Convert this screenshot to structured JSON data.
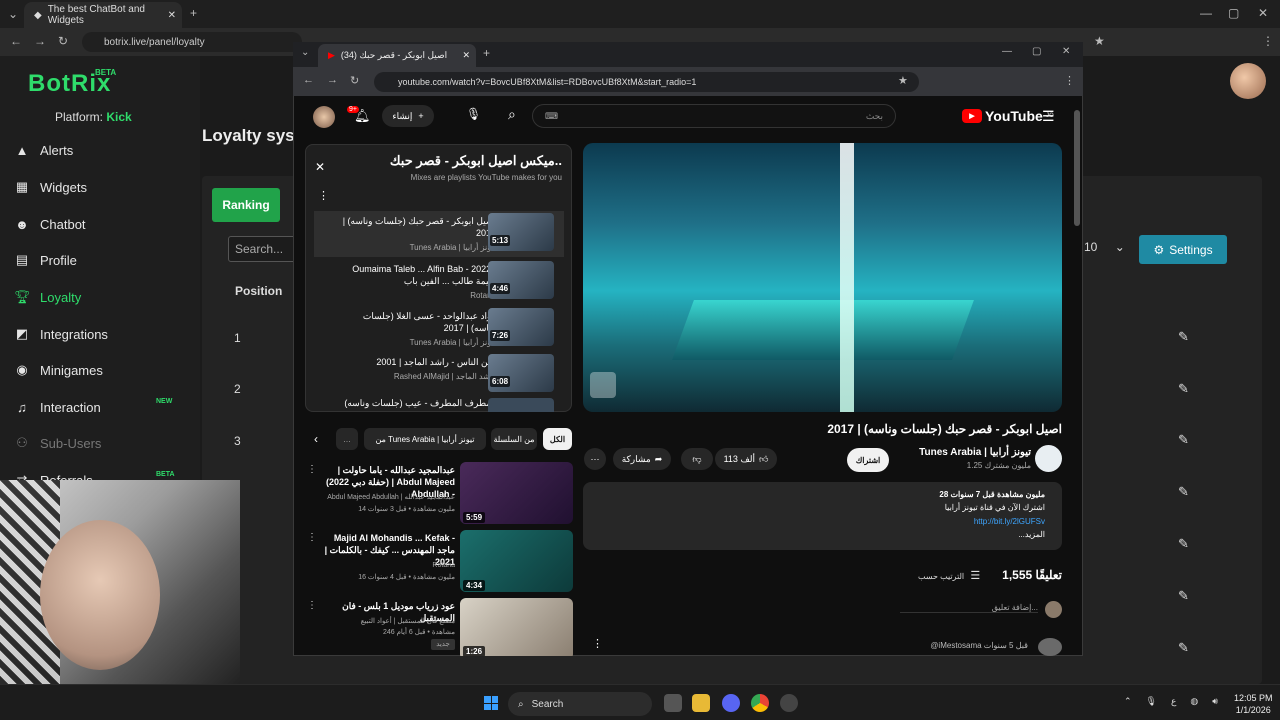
{
  "outer_browser": {
    "tab_title": "The best ChatBot and Widgets",
    "url": "botrix.live/panel/loyalty"
  },
  "botrix": {
    "brand": "BotRix",
    "beta": "BETA",
    "platform_label": "Platform:",
    "platform_value": "Kick",
    "nav": [
      {
        "label": "Alerts",
        "icon": "warning-icon"
      },
      {
        "label": "Widgets",
        "icon": "grid-icon"
      },
      {
        "label": "Chatbot",
        "icon": "robot-icon"
      },
      {
        "label": "Profile",
        "icon": "id-card-icon"
      },
      {
        "label": "Loyalty",
        "icon": "trophy-icon"
      },
      {
        "label": "Integrations",
        "icon": "integrations-icon"
      },
      {
        "label": "Minigames",
        "icon": "gamepad-icon"
      },
      {
        "label": "Interaction",
        "icon": "music-icon",
        "badge": "NEW"
      },
      {
        "label": "Sub-Users",
        "icon": "users-icon"
      },
      {
        "label": "Referrals",
        "icon": "referral-icon",
        "badge": "BETA"
      }
    ],
    "page_title": "Loyalty syst",
    "ranking_label": "Ranking",
    "search_placeholder": "Search...",
    "page_size": "10",
    "settings_label": "Settings",
    "col_position": "Position",
    "positions": [
      "1",
      "2",
      "3"
    ]
  },
  "youtube_window": {
    "tab_title": "(34) اصيل ابوبكر - قصر حبك",
    "url": "youtube.com/watch?v=BovcUBf8XtM&list=RDBovcUBf8XtM&start_radio=1",
    "logo_text": "YouTube",
    "logo_region": "JO",
    "search_placeholder": "بحث",
    "create_label": "إنشاء",
    "notif_count": "9+",
    "mix_title": "ميكس اصيل ابوبكر - قصر حبك..",
    "mix_subtitle": "Mixes are playlists YouTube makes for you",
    "playlist": [
      {
        "title": "اصيل ابوبكر - قصر حبك (جلسات وناسه) | 2017",
        "channel": "Tunes Arabia | تيونز أرابيا",
        "duration": "5:13"
      },
      {
        "title": "Oumaima Taleb ... Alfin Bab - 2022 | اميمة طالب ... الفين باب",
        "channel": "Rotana",
        "duration": "4:46"
      },
      {
        "title": "فؤاد عبدالواحد - عسى الغلا (جلسات وناسه) | 2017",
        "channel": "Tunes Arabia | تيونز أرابيا",
        "duration": "7:26"
      },
      {
        "title": "عين الناس - راشد الماجد | 2001",
        "channel": "Rashed AlMajid | راشد الماجد",
        "duration": "6:08"
      },
      {
        "title": "مطرف المطرف - عيب (جلسات وناسه) |",
        "channel": "",
        "duration": ""
      }
    ],
    "chips": [
      "الكل",
      "من السلسلة",
      "من Tunes Arabia | تيونز أرابيا"
    ],
    "related": [
      {
        "title": "عبدالمجيد عبدالله - ياما حاولت | (حفلة دبي 2022) | Abdul Majeed Abdullah -",
        "channel": "Abdul Majeed Abdullah | عبدالمجيد عبدالله",
        "meta": "14 مليون مشاهدة • قبل 3 سنوات",
        "duration": "5:59"
      },
      {
        "title": "Majid Al Mohandis ... Kefak - ماجد المهندس ... كيفك - بالكلمات | 2021",
        "channel": "Rotana",
        "meta": "16 مليون مشاهدة • قبل 4 سنوات",
        "duration": "4:34"
      },
      {
        "title": "عود زرياب موديل 1 بلس - فان المستقبل",
        "channel": "مصنع فان المستقبل | أعواد التبيع",
        "meta": "246 مشاهدة • قبل 6 أيام",
        "duration": "1:26",
        "badge": "جديد"
      }
    ],
    "video_title": "اصيل ابوبكر - قصر حبك (جلسات وناسه) | 2017",
    "channel_name": "Tunes Arabia | تيونز أرابيا",
    "channel_subs": "1.25 مليون مشترك",
    "subscribe_label": "اشتراك",
    "likes": "113 ألف",
    "share_label": "مشاركة",
    "desc_views": "28 مليون مشاهدة  قبل 7 سنوات",
    "desc_line2": "اشترك الآن في قناة تيونز أرابيا",
    "desc_link": "http://bit.ly/2lGUFSv",
    "desc_more": "...المزيد",
    "comments_count": "1,555 تعليقًا",
    "sort_label": "الترتيب حسب",
    "add_comment": "إضافة تعليق...",
    "comment_author": "@iMestosama قبل 5 سنوات"
  },
  "taskbar": {
    "search_label": "Search",
    "time": "12:05 PM",
    "date": "1/1/2026",
    "lang": "ع"
  }
}
